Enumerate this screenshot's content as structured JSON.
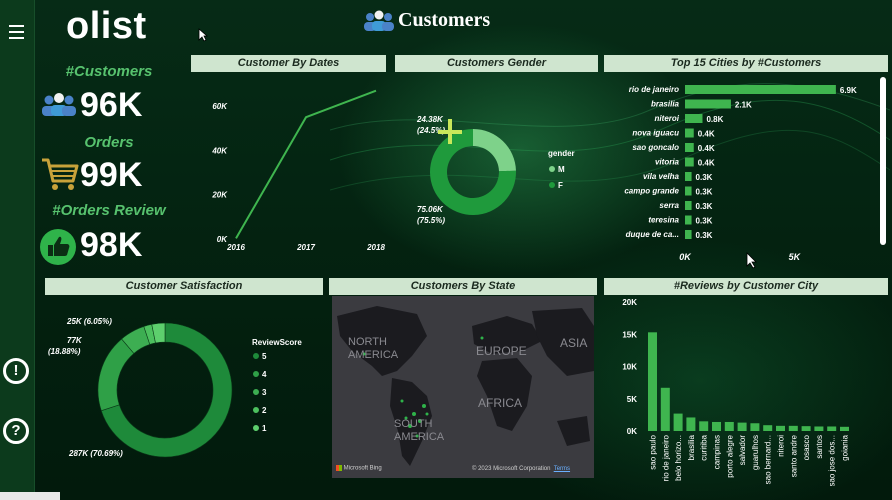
{
  "brand": "olist",
  "header": {
    "title": "Customers",
    "icon": "people-icon"
  },
  "kpis": [
    {
      "label": "#Customers",
      "value": "96K",
      "icon": "people-icon"
    },
    {
      "label": "Orders",
      "value": "99K",
      "icon": "cart-icon"
    },
    {
      "label": "#Orders Review",
      "value": "98K",
      "icon": "thumbs-up-icon"
    }
  ],
  "panels": {
    "by_dates": "Customer By Dates",
    "gender": "Customers Gender",
    "top_cities": "Top 15 Cities by #Customers",
    "satisfaction": "Customer Satisfaction",
    "by_state": "Customers By State",
    "reviews_city": "#Reviews by Customer City"
  },
  "map": {
    "labels": [
      "NORTH AMERICA",
      "EUROPE",
      "ASIA",
      "AFRICA",
      "SOUTH AMERICA"
    ],
    "credit_logo": "Microsoft Bing",
    "copyright": "© 2023 Microsoft Corporation",
    "terms": "Terms"
  },
  "colors": {
    "accent": "#3fb54f",
    "panel_title_bg": "#cfe5cf",
    "background": "#04200f"
  },
  "chart_data": [
    {
      "type": "line",
      "x": [
        "2016",
        "2017",
        "2018"
      ],
      "values": [
        300,
        55000,
        67000
      ],
      "yticks": [
        "0K",
        "20K",
        "40K",
        "60K"
      ],
      "ylim": [
        0,
        70000
      ]
    },
    {
      "type": "pie",
      "legend_title": "gender",
      "labels": [
        "M",
        "F"
      ],
      "values": [
        24380,
        75060
      ],
      "data_labels": [
        "24.38K",
        "(24.5%)",
        "75.06K",
        "(75.5%)"
      ],
      "colors": [
        "#7ed28a",
        "#1f9a3c"
      ]
    },
    {
      "type": "bar",
      "orientation": "horizontal",
      "categories": [
        "rio de janeiro",
        "brasilia",
        "niteroi",
        "nova iguacu",
        "sao goncalo",
        "vitoria",
        "vila velha",
        "campo grande",
        "serra",
        "teresina",
        "duque de ca..."
      ],
      "values": [
        6900,
        2100,
        800,
        400,
        400,
        400,
        300,
        300,
        300,
        300,
        300
      ],
      "data_labels": [
        "6.9K",
        "2.1K",
        "0.8K",
        "0.4K",
        "0.4K",
        "0.4K",
        "0.3K",
        "0.3K",
        "0.3K",
        "0.3K",
        "0.3K"
      ],
      "xticks": [
        "0K",
        "5K"
      ],
      "xlim": [
        0,
        7500
      ]
    },
    {
      "type": "pie",
      "legend_title": "ReviewScore",
      "labels": [
        "5",
        "4",
        "3",
        "2",
        "1"
      ],
      "values": [
        287000,
        77000,
        25000,
        8000,
        13000
      ],
      "data_labels": [
        "25K (6.05%)",
        "77K",
        "(18.88%)",
        "287K (70.69%)"
      ],
      "colors": [
        "#1e8a3a",
        "#2fa047",
        "#3dae52",
        "#4cc05e",
        "#5dcf6d"
      ]
    },
    {
      "type": "bar",
      "categories": [
        "sao paulo",
        "rio de janeiro",
        "belo horizo...",
        "brasilia",
        "curitiba",
        "campinas",
        "porto alegre",
        "salvador",
        "guarulhos",
        "sao bernard...",
        "niteroi",
        "santo andre",
        "osasco",
        "santos",
        "sao jose dos...",
        "goiania"
      ],
      "values": [
        15300,
        6700,
        2700,
        2100,
        1500,
        1400,
        1400,
        1300,
        1200,
        900,
        800,
        800,
        750,
        700,
        700,
        650
      ],
      "yticks": [
        "0K",
        "5K",
        "10K",
        "15K",
        "20K"
      ],
      "ylim": [
        0,
        20000
      ]
    }
  ]
}
